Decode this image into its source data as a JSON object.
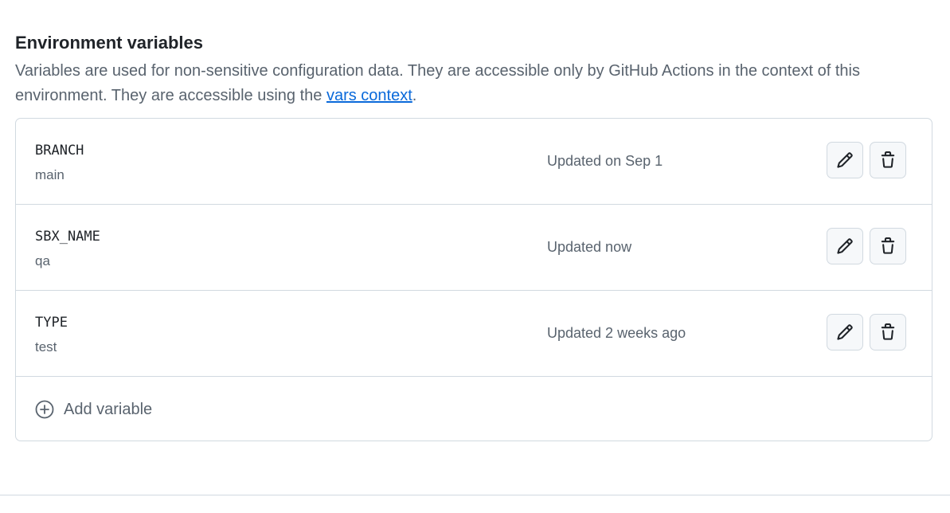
{
  "section": {
    "title": "Environment variables",
    "description_before_link": "Variables are used for non-sensitive configuration data. They are accessible only by GitHub Actions in the context of this environment. They are accessible using the ",
    "link_text": "vars context",
    "description_after_link": "."
  },
  "variables": [
    {
      "name": "BRANCH",
      "value": "main",
      "updated": "Updated on Sep 1"
    },
    {
      "name": "SBX_NAME",
      "value": "qa",
      "updated": "Updated now"
    },
    {
      "name": "TYPE",
      "value": "test",
      "updated": "Updated 2 weeks ago"
    }
  ],
  "add_variable_label": "Add variable",
  "icons": {
    "edit": "pencil-icon",
    "delete": "trash-icon",
    "add": "plus-circle-icon"
  },
  "colors": {
    "link": "#0969da",
    "muted_text": "#59636e",
    "border": "#d1d9e0",
    "button_bg": "#f6f8fa"
  }
}
